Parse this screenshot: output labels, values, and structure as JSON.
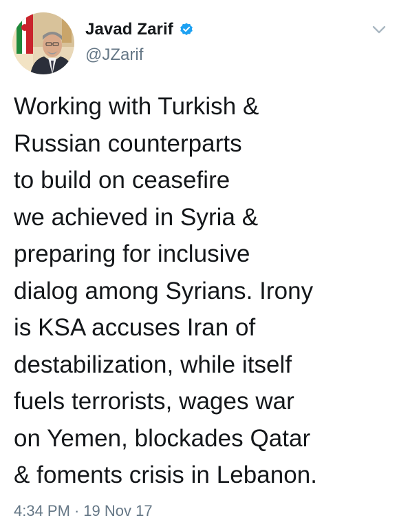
{
  "user": {
    "display_name": "Javad Zarif",
    "handle": "@JZarif",
    "verified": true,
    "avatar_icon": "profile-photo"
  },
  "tweet": {
    "text": "Working with Turkish &\nRussian counterparts\nto build on ceasefire\nwe achieved in Syria &\npreparing for inclusive\ndialog among Syrians. Irony\nis KSA accuses Iran of\ndestabilization, while itself\nfuels terrorists, wages war\non Yemen, blockades Qatar\n& foments crisis in Lebanon.",
    "time": "4:34 PM",
    "separator": "·",
    "date": "19 Nov 17"
  },
  "icons": {
    "verified": "verified-badge-icon",
    "menu": "chevron-down-icon"
  },
  "colors": {
    "text": "#14171a",
    "secondary": "#657786",
    "verified_blue": "#1da1f2",
    "background": "#ffffff"
  }
}
